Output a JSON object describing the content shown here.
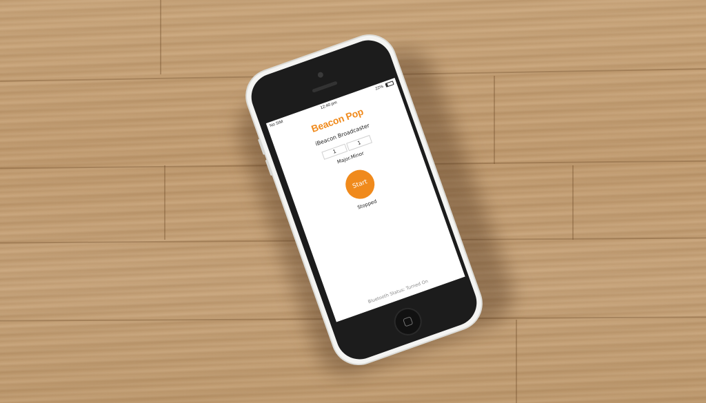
{
  "status_bar": {
    "carrier": "No SIM",
    "time": "12:40 pm",
    "battery": "22%"
  },
  "app": {
    "title": "Beacon Pop",
    "subtitle": "iBeacon Broadcaster",
    "major_value": "1",
    "minor_value": "1",
    "fields_label": "Major.Minor",
    "start_label": "Start",
    "state_text": "Stopped",
    "bluetooth_status": "Bluetooth Status: Turned On"
  },
  "colors": {
    "accent": "#f08a1c",
    "phone_body": "#f4f4f2",
    "table": "#c29c70"
  }
}
